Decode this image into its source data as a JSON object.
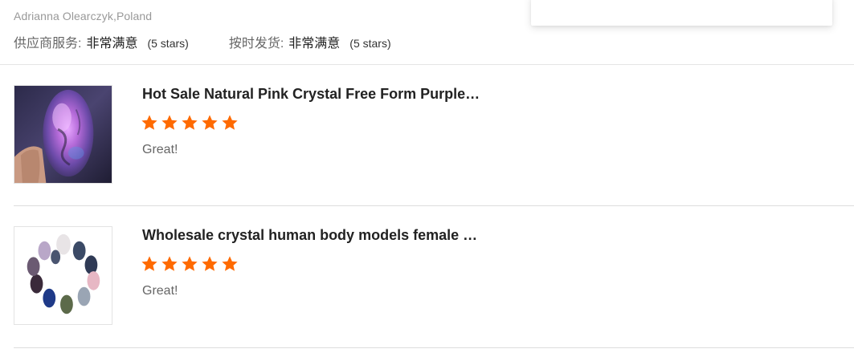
{
  "reviewer": {
    "name_country": "Adrianna Olearczyk,Poland"
  },
  "ratings": [
    {
      "label": "供应商服务:",
      "value": "非常满意",
      "stars_text": "(5 stars)"
    },
    {
      "label": "按时发货:",
      "value": "非常满意",
      "stars_text": "(5 stars)"
    }
  ],
  "reviews": [
    {
      "product_title": "Hot Sale Natural Pink Crystal Free Form Purple…",
      "rating": 5,
      "text": "Great!",
      "thumbnail_icon": "labradorite-crystal-photo"
    },
    {
      "product_title": "Wholesale crystal human body models female …",
      "rating": 5,
      "text": "Great!",
      "thumbnail_icon": "crystal-body-figurines-photo"
    }
  ],
  "colors": {
    "star": "#ff6a00",
    "divider": "#e5e5e5",
    "muted_text": "#999999"
  }
}
